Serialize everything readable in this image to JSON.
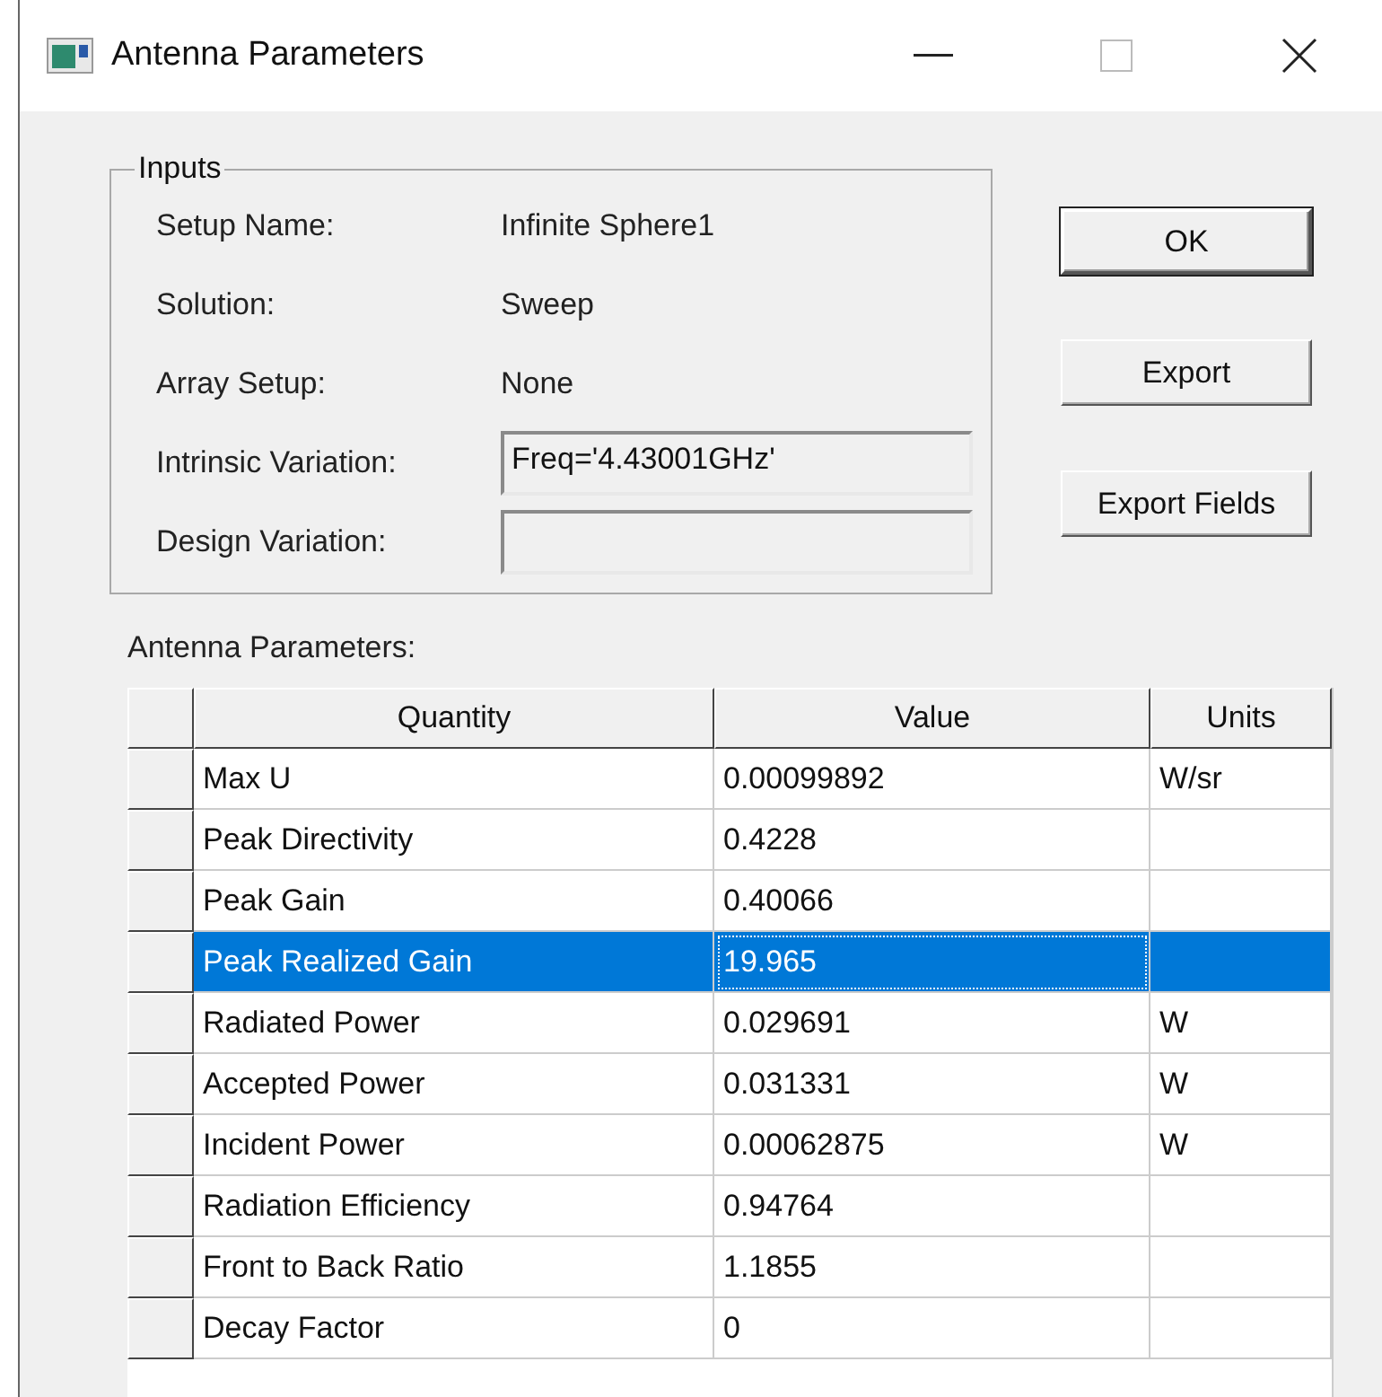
{
  "window": {
    "title": "Antenna Parameters"
  },
  "inputs": {
    "title": "Inputs",
    "fields": [
      {
        "label": "Setup Name:",
        "value": "Infinite Sphere1",
        "kind": "text"
      },
      {
        "label": "Solution:",
        "value": "Sweep",
        "kind": "text"
      },
      {
        "label": "Array Setup:",
        "value": "None",
        "kind": "text"
      },
      {
        "label": "Intrinsic Variation:",
        "value": "Freq='4.43001GHz'",
        "kind": "field"
      },
      {
        "label": "Design Variation:",
        "kind": "field"
      }
    ]
  },
  "buttons": [
    {
      "label": "OK",
      "default": true
    },
    {
      "label": "Export",
      "default": false
    },
    {
      "label": "Export Fields",
      "default": false
    }
  ],
  "table": {
    "label": "Antenna Parameters:",
    "columns": [
      "Quantity",
      "Value",
      "Units"
    ],
    "rows": [
      {
        "quantity": "Max U",
        "value": "0.00099892",
        "units": "W/sr",
        "selected": false
      },
      {
        "quantity": "Peak Directivity",
        "value": "0.4228",
        "selected": false
      },
      {
        "quantity": "Peak Gain",
        "value": "0.40066",
        "selected": false
      },
      {
        "quantity": "Peak Realized Gain",
        "value": "19.965",
        "selected": true
      },
      {
        "quantity": "Radiated Power",
        "value": "0.029691",
        "units": "W",
        "selected": false
      },
      {
        "quantity": "Accepted Power",
        "value": "0.031331",
        "units": "W",
        "selected": false
      },
      {
        "quantity": "Incident Power",
        "value": "0.00062875",
        "units": "W",
        "selected": false
      },
      {
        "quantity": "Radiation Efficiency",
        "value": "0.94764",
        "selected": false
      },
      {
        "quantity": "Front to Back Ratio",
        "value": "1.1855",
        "selected": false
      },
      {
        "quantity": "Decay Factor",
        "value": "0",
        "selected": false
      }
    ]
  }
}
